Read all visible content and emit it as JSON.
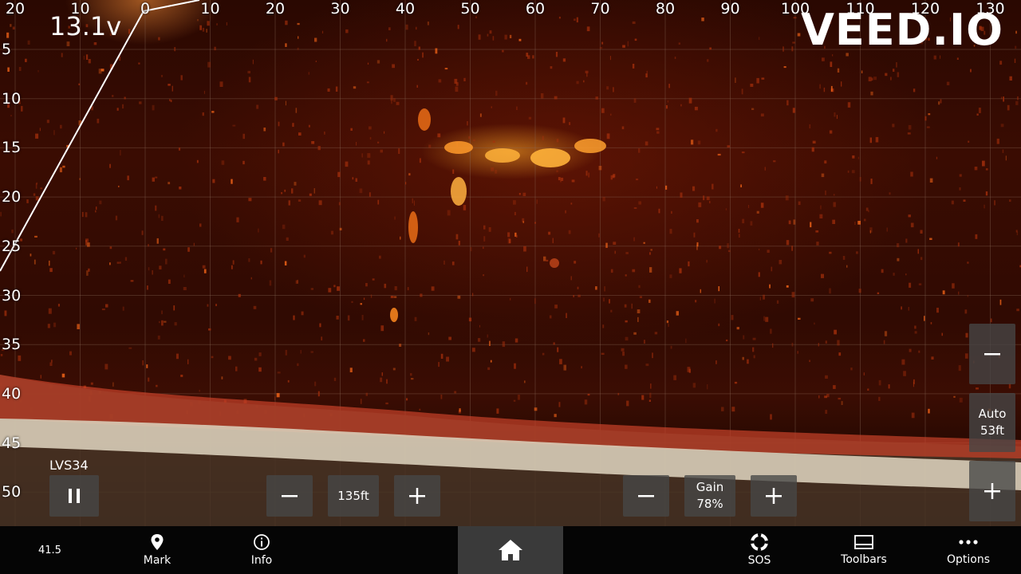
{
  "sonar": {
    "top_scale": [
      "20",
      "10",
      "0",
      "10",
      "20",
      "30",
      "40",
      "50",
      "60",
      "70",
      "80",
      "90",
      "100",
      "110",
      "120",
      "130"
    ],
    "side_scale": [
      "5",
      "10",
      "15",
      "20",
      "25",
      "30",
      "35",
      "40",
      "45",
      "50"
    ],
    "voltage": "13.1v",
    "watermark": "VEED.IO",
    "source_label": "LVS34"
  },
  "range": {
    "value": "135ft",
    "decrease_icon": "minus-icon",
    "increase_icon": "plus-icon"
  },
  "gain": {
    "label": "Gain",
    "value": "78%",
    "decrease_icon": "minus-icon",
    "increase_icon": "plus-icon"
  },
  "depth_range": {
    "auto_label": "Auto",
    "value": "53ft"
  },
  "pause_icon": "pause-icon",
  "bottom_bar": {
    "depth_readout": "41.5",
    "items": [
      {
        "label": "Mark",
        "icon": "pin-icon"
      },
      {
        "label": "Info",
        "icon": "info-icon"
      },
      {
        "label": "",
        "icon": "home-icon"
      },
      {
        "label": "SOS",
        "icon": "lifebuoy-icon"
      },
      {
        "label": "Toolbars",
        "icon": "toolbars-icon"
      },
      {
        "label": "Options",
        "icon": "more-icon"
      }
    ]
  },
  "colors": {
    "echo": "#ff8a1e",
    "bottom": "#d8cdb8",
    "background": "#2a0801",
    "panel": "#464646"
  }
}
